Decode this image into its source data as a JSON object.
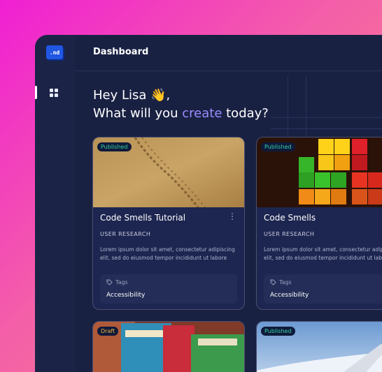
{
  "logo": {
    "text": ".nd"
  },
  "sidebar": {
    "items": [
      {
        "icon": "grid-icon",
        "active": true
      }
    ]
  },
  "header": {
    "title": "Dashboard"
  },
  "greeting": {
    "line1": "Hey Lisa 👋,",
    "line2_prefix": "What will you ",
    "line2_accent": "create",
    "line2_suffix": " today?"
  },
  "colors": {
    "accent": "#9a8cff",
    "published": "#35d0a5",
    "draft": "#f0b040"
  },
  "cards": [
    {
      "status": "Published",
      "title": "Code Smells Tutorial",
      "category": "USER RESEARCH",
      "description": "Lorem ipsum dolor sit amet, consectetur adipiscing elit, sed do eiusmod tempor incididunt ut labore",
      "tags_label": "Tags",
      "tag": "Accessibility",
      "image": "sand-footprints"
    },
    {
      "status": "Published",
      "title": "Code Smells",
      "category": "USER RESEARCH",
      "description": "Lorem ipsum dolor sit amet, consectetur adipiscing elit, sed do eiusmod tempor incididunt ut labore",
      "tags_label": "Tags",
      "tag": "Accessibility",
      "image": "tetris-blocks"
    },
    {
      "status": "Draft",
      "image": "design-books"
    },
    {
      "status": "Published",
      "image": "airplane-wing"
    }
  ]
}
